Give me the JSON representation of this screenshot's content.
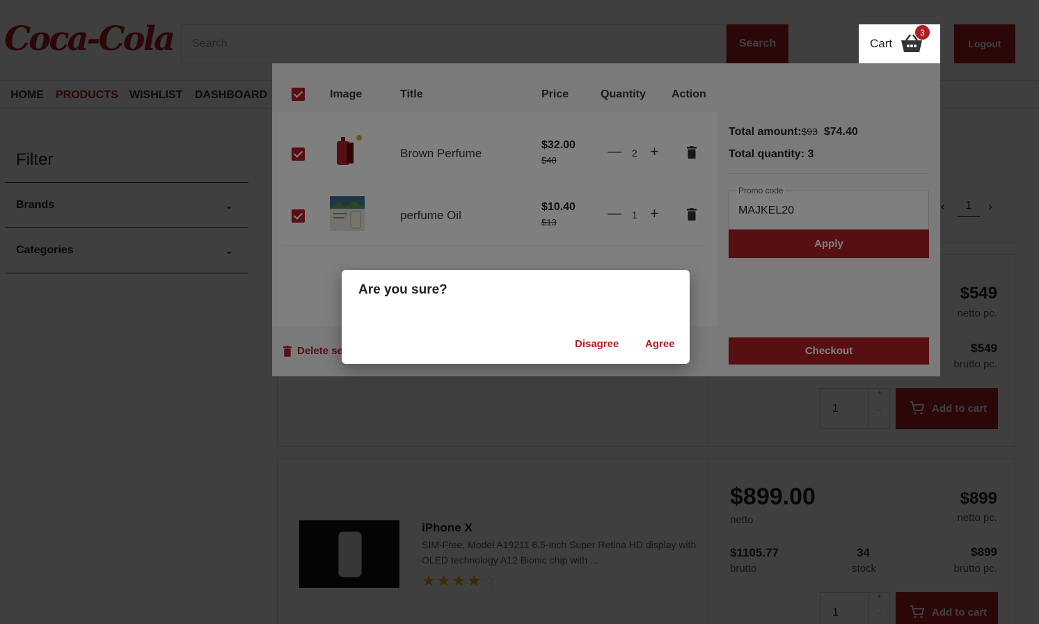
{
  "header": {
    "logo_text": "Coca-Cola",
    "search_placeholder": "Search",
    "search_button": "Search",
    "cart_label": "Cart",
    "cart_count": "3",
    "logout_button": "Logout"
  },
  "nav": {
    "items": [
      "HOME",
      "PRODUCTS",
      "WISHLIST",
      "DASHBOARD"
    ],
    "active": "PRODUCTS"
  },
  "filter": {
    "title": "Filter",
    "sections": [
      "Brands",
      "Categories"
    ]
  },
  "pagination": {
    "page": "1"
  },
  "products": [
    {
      "price_pc": "$549",
      "price_pc_label": "netto pc.",
      "brutto_pc": "$549",
      "brutto_pc_label": "brutto pc.",
      "qty": "1",
      "add_label": "Add to cart"
    },
    {
      "title": "iPhone X",
      "description": "SIM-Free, Model A19211 6.5-inch Super Retina HD display with OLED technology A12 Bionic chip with ...",
      "rating": 4,
      "price": "$899.00",
      "price_label": "netto",
      "price_pc": "$899",
      "price_pc_label": "netto pc.",
      "brutto": "$1105.77",
      "brutto_label": "brutto",
      "stock": "34",
      "stock_label": "stock",
      "brutto_pc": "$899",
      "brutto_pc_label": "brutto pc.",
      "qty": "1",
      "add_label": "Add to cart"
    }
  ],
  "cart": {
    "columns": [
      "Image",
      "Title",
      "Price",
      "Quantity",
      "Action"
    ],
    "items": [
      {
        "title": "Brown Perfume",
        "price": "$32.00",
        "old_price": "$40",
        "qty": "2"
      },
      {
        "title": "perfume Oil",
        "price": "$10.40",
        "old_price": "$13",
        "qty": "1"
      }
    ],
    "total_amount_label": "Total amount:",
    "total_amount_old": "$93",
    "total_amount": "$74.40",
    "total_quantity_label": "Total quantity:",
    "total_quantity": "3",
    "promo_label": "Promo code",
    "promo_value": "MAJKEL20",
    "apply_button": "Apply",
    "delete_selected": "Delete se",
    "checkout_button": "Checkout"
  },
  "dialog": {
    "question": "Are you sure?",
    "disagree": "Disagree",
    "agree": "Agree"
  },
  "colors": {
    "brand": "#b01e23",
    "star": "#f4a400"
  }
}
